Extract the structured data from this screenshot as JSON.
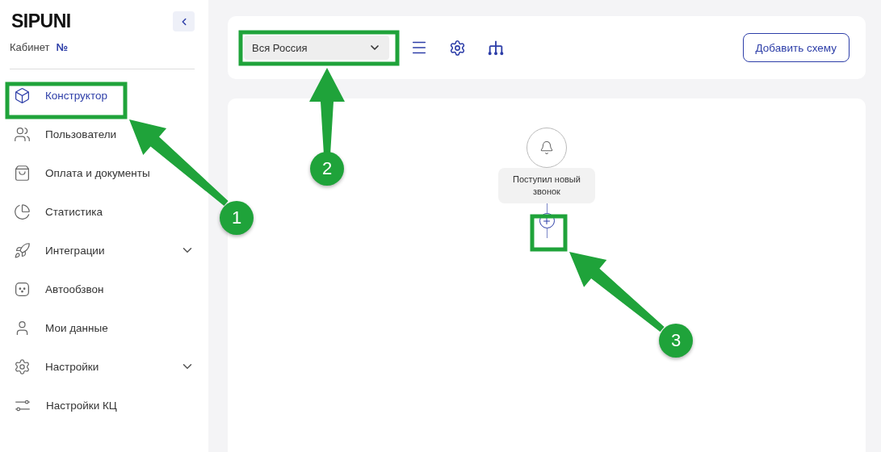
{
  "sidebar": {
    "logo": "SIPUNI",
    "cabinet_label": "Кабинет",
    "cabinet_number": "№",
    "items": [
      {
        "label": "Конструктор",
        "kind": "link",
        "selected": true
      },
      {
        "label": "Пользователи",
        "kind": "link",
        "selected": false
      },
      {
        "label": "Оплата и документы",
        "kind": "link",
        "selected": false
      },
      {
        "label": "Статистика",
        "kind": "link",
        "selected": false
      },
      {
        "label": "Интеграции",
        "kind": "group",
        "selected": false
      },
      {
        "label": "Автообзвон",
        "kind": "link",
        "selected": false
      },
      {
        "label": "Мои данные",
        "kind": "link",
        "selected": false
      },
      {
        "label": "Настройки",
        "kind": "group",
        "selected": false
      },
      {
        "label": "Настройки КЦ",
        "kind": "link",
        "selected": false
      }
    ]
  },
  "toolbar": {
    "region_select": {
      "value": "Вся Россия"
    },
    "add_button": "Добавить схему"
  },
  "canvas": {
    "node": {
      "label": "Поступил новый звонок"
    }
  },
  "annotations": [
    {
      "label": "1"
    },
    {
      "label": "2"
    },
    {
      "label": "3"
    }
  ]
}
